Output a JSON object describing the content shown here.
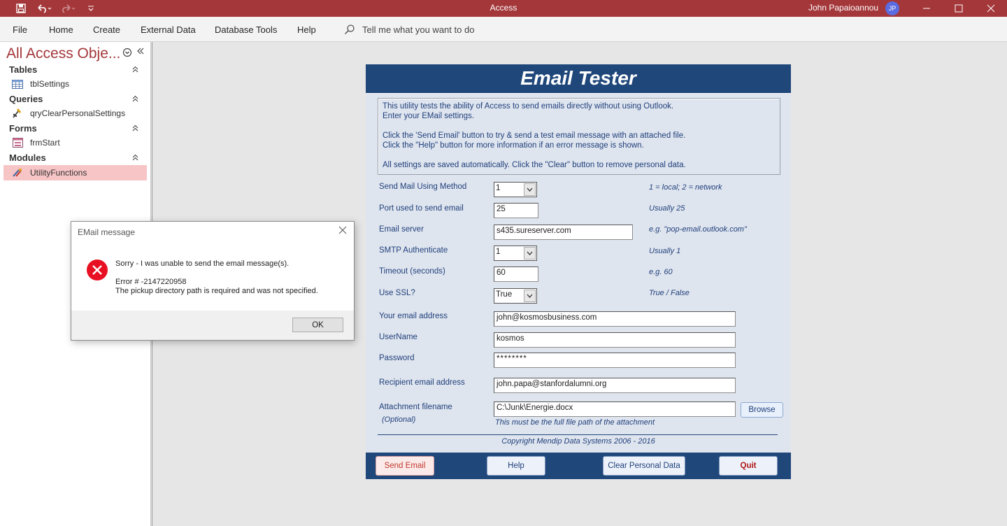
{
  "app": {
    "title": "Access",
    "user_name": "John Papaioannou",
    "user_initials": "JP"
  },
  "menu": {
    "items": [
      "File",
      "Home",
      "Create",
      "External Data",
      "Database Tools",
      "Help"
    ],
    "tell_me": "Tell me what you want to do"
  },
  "nav": {
    "title": "All Access Obje...",
    "groups": [
      {
        "label": "Tables",
        "items": [
          "tblSettings"
        ]
      },
      {
        "label": "Queries",
        "items": [
          "qryClearPersonalSettings"
        ]
      },
      {
        "label": "Forms",
        "items": [
          "frmStart"
        ]
      },
      {
        "label": "Modules",
        "items": [
          "UtilityFunctions"
        ]
      }
    ]
  },
  "form": {
    "title": "Email Tester",
    "info": [
      "This utility tests the ability of Access to send emails directly without using Outlook.",
      "Enter your EMail settings.",
      "Click the 'Send Email' button to try & send a test email message with an attached file.",
      "Click the \"Help\" button for more information if an error message is shown.",
      "All settings are saved automatically. Click the \"Clear\" button to remove personal data."
    ],
    "fields": {
      "method": {
        "label": "Send Mail Using Method",
        "value": "1",
        "hint": "1 = local; 2 = network"
      },
      "port": {
        "label": "Port used to send email",
        "value": "25",
        "hint": "Usually 25"
      },
      "server": {
        "label": "Email server",
        "value": "s435.sureserver.com",
        "hint": "e.g. \"pop-email.outlook.com\""
      },
      "smtp_auth": {
        "label": "SMTP Authenticate",
        "value": "1",
        "hint": "Usually 1"
      },
      "timeout": {
        "label": "Timeout (seconds)",
        "value": "60",
        "hint": "e.g. 60"
      },
      "ssl": {
        "label": "Use SSL?",
        "value": "True",
        "hint": "True / False"
      },
      "email": {
        "label": "Your email address",
        "value": "john@kosmosbusiness.com"
      },
      "username": {
        "label": "UserName",
        "value": "kosmos"
      },
      "password": {
        "label": "Password",
        "value": "********"
      },
      "recipient": {
        "label": "Recipient email address",
        "value": "john.papa@stanfordalumni.org"
      },
      "attachment": {
        "label": "Attachment filename",
        "sublabel": "(Optional)",
        "value": "C:\\Junk\\Energie.docx",
        "hint": "This must be the full file path of the attachment"
      }
    },
    "browse_label": "Browse",
    "copyright": "Copyright Mendip Data Systems 2006 - 2016",
    "buttons": {
      "send": "Send Email",
      "help": "Help",
      "clear": "Clear Personal Data",
      "quit": "Quit"
    }
  },
  "dialog": {
    "title": "EMail message",
    "message": "Sorry - I was unable to send the email message(s).",
    "error_code": "Error # -2147220958",
    "error_text": "The pickup directory path is required and was not specified.",
    "ok_label": "OK"
  },
  "colors": {
    "accent": "#a4373a",
    "form_blue": "#1f477a",
    "selected_nav": "#f8c5c6"
  }
}
